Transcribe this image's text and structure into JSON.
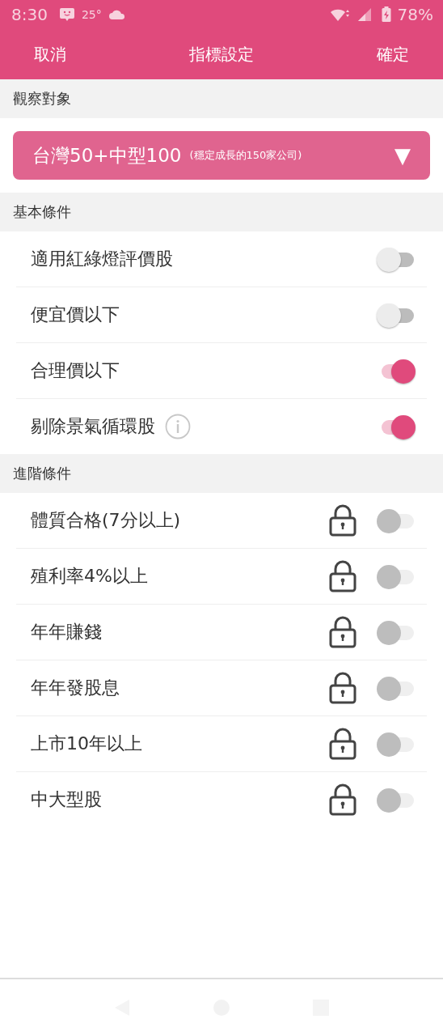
{
  "status_bar": {
    "time": "8:30",
    "temperature": "25°",
    "battery": "78%"
  },
  "header": {
    "cancel": "取消",
    "title": "指標設定",
    "confirm": "確定"
  },
  "target": {
    "heading": "觀察對象",
    "value": "台灣50+中型100",
    "note": "(穩定成長的150家公司)",
    "arrow": "▼"
  },
  "sections": [
    {
      "heading": "基本條件",
      "items": [
        {
          "label": "適用紅綠燈評價股",
          "info": false,
          "locked": false,
          "on": false
        },
        {
          "label": "便宜價以下",
          "info": false,
          "locked": false,
          "on": false
        },
        {
          "label": "合理價以下",
          "info": false,
          "locked": false,
          "on": true
        },
        {
          "label": "剔除景氣循環股",
          "info": true,
          "locked": false,
          "on": true
        }
      ]
    },
    {
      "heading": "進階條件",
      "items": [
        {
          "label": "體質合格(7分以上)",
          "info": false,
          "locked": true,
          "on": false
        },
        {
          "label": "殖利率4%以上",
          "info": false,
          "locked": true,
          "on": false
        },
        {
          "label": "年年賺錢",
          "info": false,
          "locked": true,
          "on": false
        },
        {
          "label": "年年發股息",
          "info": false,
          "locked": true,
          "on": false
        },
        {
          "label": "上市10年以上",
          "info": false,
          "locked": true,
          "on": false
        },
        {
          "label": "中大型股",
          "info": false,
          "locked": true,
          "on": false
        }
      ]
    }
  ]
}
